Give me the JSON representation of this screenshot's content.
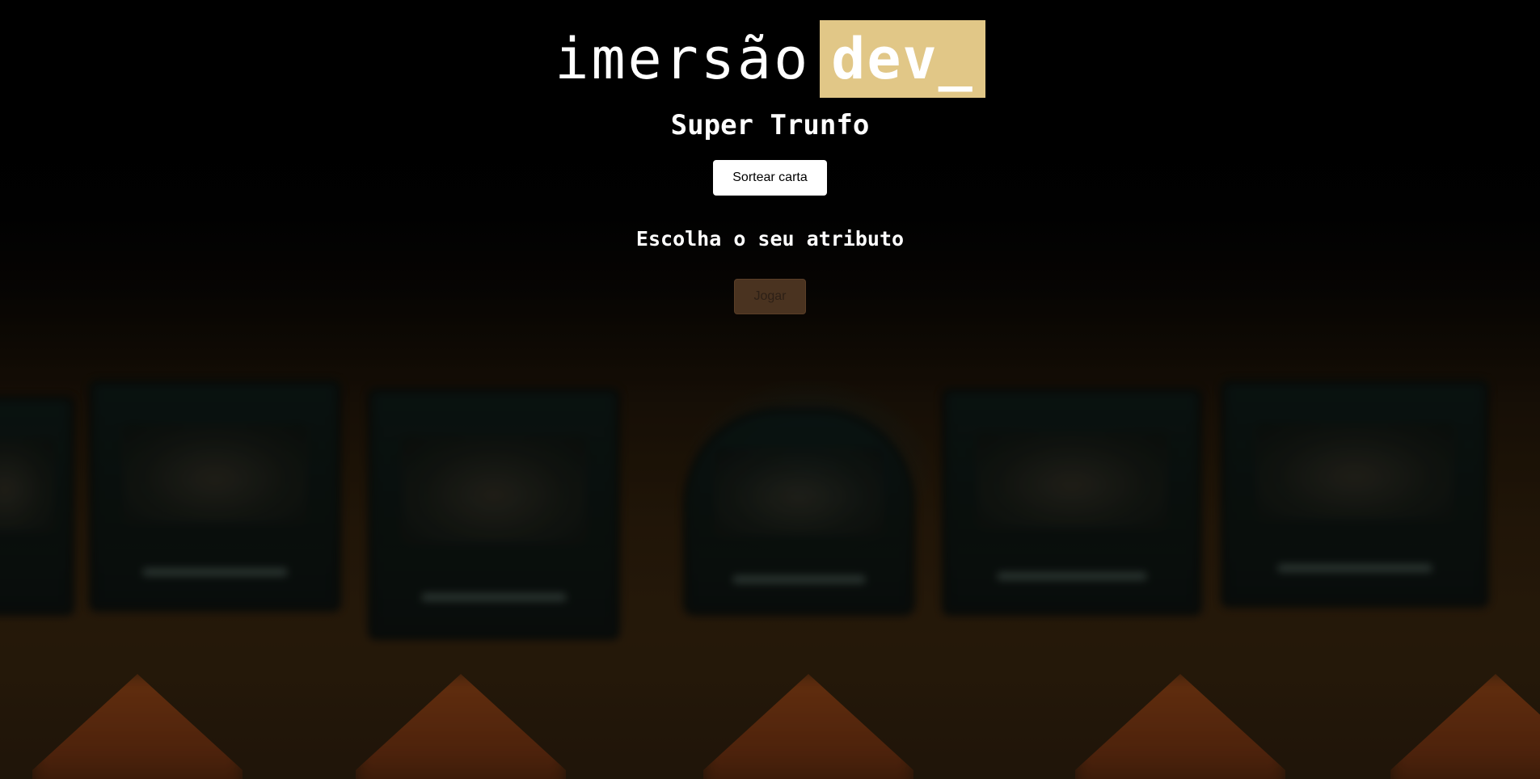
{
  "header": {
    "logo_text": "imersão",
    "logo_highlight": "dev_",
    "logo_highlight_color": "#e1c787",
    "title": "Super Trunfo"
  },
  "actions": {
    "draw_card_label": "Sortear carta",
    "play_label": "Jogar",
    "play_enabled": false
  },
  "attribute_section": {
    "prompt": "Escolha o seu atributo"
  },
  "colors": {
    "page_background": "#000000",
    "text": "#ffffff",
    "draw_button_background": "#ffffff",
    "play_button_background": "#4a3320"
  }
}
